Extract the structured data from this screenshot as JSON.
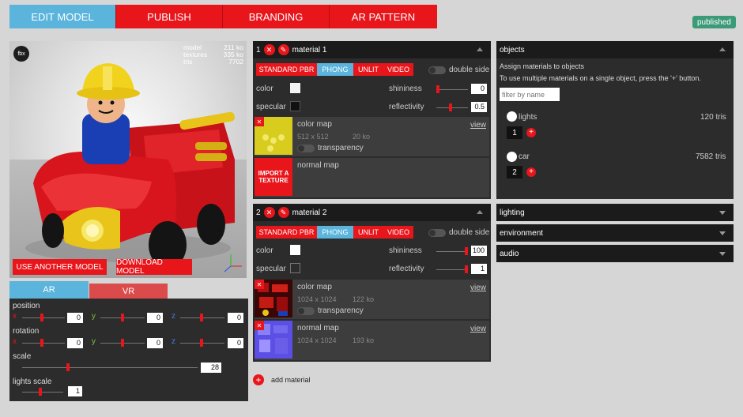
{
  "top_tabs": [
    {
      "label": "EDIT MODEL"
    },
    {
      "label": "PUBLISH"
    },
    {
      "label": "BRANDING"
    },
    {
      "label": "AR PATTERN"
    }
  ],
  "published_badge": "published",
  "viewer": {
    "format_icon": "fbx",
    "stats": [
      {
        "label": "model",
        "value": "211 ko"
      },
      {
        "label": "textures",
        "value": "335 ko"
      },
      {
        "label": "tris",
        "value": "7702"
      }
    ],
    "use_another_label": "USE ANOTHER MODEL",
    "download_label": "DOWNLOAD MODEL"
  },
  "ar_tabs": [
    {
      "label": "AR"
    },
    {
      "label": "VR"
    }
  ],
  "ar": {
    "position_label": "position",
    "rotation_label": "rotation",
    "scale_label": "scale",
    "lights_scale_label": "lights scale",
    "axis_x": "x",
    "axis_y": "y",
    "axis_z": "z",
    "position": {
      "x": "0",
      "y": "0",
      "z": "0"
    },
    "rotation": {
      "x": "0",
      "y": "0",
      "z": "0"
    },
    "scale": "28",
    "lights_scale": "1"
  },
  "shader_tabs": [
    "STANDARD PBR",
    "PHONG",
    "UNLIT",
    "VIDEO"
  ],
  "materials": [
    {
      "index": "1",
      "name": "material 1",
      "double_side": "double side",
      "color_label": "color",
      "specular_label": "specular",
      "shininess_label": "shininess",
      "shininess": "0",
      "reflectivity_label": "reflectivity",
      "reflectivity": "0.5",
      "color_map": {
        "label": "color map",
        "dims": "512 x 512",
        "size": "20 ko",
        "view": "view",
        "transparency": "transparency"
      },
      "normal_map": {
        "label": "normal map",
        "import_label": "IMPORT A TEXTURE"
      }
    },
    {
      "index": "2",
      "name": "material 2",
      "double_side": "double side",
      "color_label": "color",
      "specular_label": "specular",
      "shininess_label": "shininess",
      "shininess": "100",
      "reflectivity_label": "reflectivity",
      "reflectivity": "1",
      "color_map": {
        "label": "color map",
        "dims": "1024 x 1024",
        "size": "122 ko",
        "view": "view",
        "transparency": "transparency"
      },
      "normal_map": {
        "label": "normal map",
        "dims": "1024 x 1024",
        "size": "193 ko",
        "view": "view"
      }
    }
  ],
  "add_material": "add material",
  "objects": {
    "title": "objects",
    "line1": "Assign materials to objects",
    "line2": "To use multiple materials on a single object, press the '+' button.",
    "filter_placeholder": "filter by name",
    "items": [
      {
        "name": "lights",
        "tris": "120 tris",
        "material": "1"
      },
      {
        "name": "car",
        "tris": "7582 tris",
        "material": "2"
      }
    ]
  },
  "side_sections": [
    {
      "label": "lighting"
    },
    {
      "label": "environment"
    },
    {
      "label": "audio"
    }
  ],
  "colors": {
    "accent_red": "#e8151b",
    "accent_blue": "#5ab4dc",
    "published_green": "#3c9a78"
  }
}
